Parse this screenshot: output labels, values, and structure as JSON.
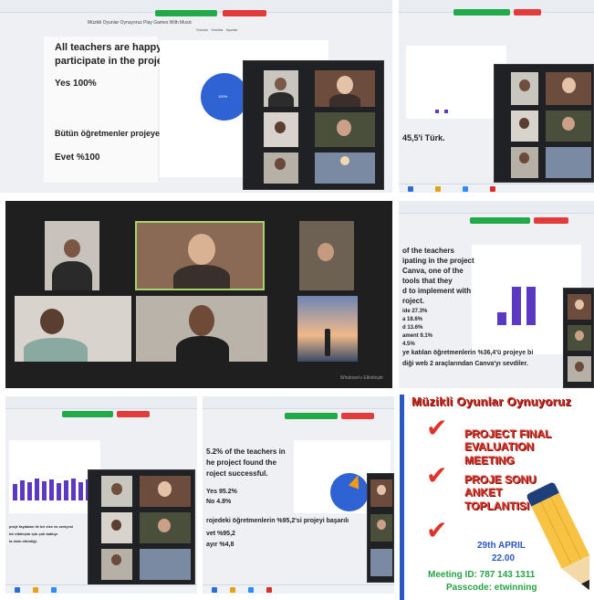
{
  "tile1": {
    "doc_title": "Müzikli Oyunlar Oynuyoruz Play Games With Music",
    "green_label": "Word canlandir | gönderimi",
    "red_label": "Toplantiyi Sonlandir",
    "tabs": [
      "Sorular",
      "Yanıtlar",
      "Ayarlar"
    ],
    "lines": [
      "All teachers are happy to",
      "participate in the project.",
      "Yes 100%",
      "Bütün öğretmenler projeye katıldıkları için mem...",
      "Evet %100"
    ],
    "pie_label": "100%"
  },
  "tile2": {
    "line": "45,5'i Türk."
  },
  "tile3": {
    "footer": "Windows'u Etkinleştir"
  },
  "tile4": {
    "lines": [
      "of the teachers",
      "ipating in the project",
      "Canva, one of the",
      "tools that they",
      "d to implement with",
      "roject.",
      "ide 27.3%",
      "a 18.6%",
      "d 13.6%",
      "ament 9.1%",
      "4.5%",
      "ye katılan öğretmenlerin %36,4'ü projeye bi",
      "diği web 2 araçlarından Canva'yı sevdiler."
    ]
  },
  "tile5": {
    "lines": [
      "proje faydaları ile bir vize vs seviyesi",
      "bir etkileşim için çok katkıyı",
      "la ekim etkinliği."
    ]
  },
  "tile6": {
    "lines": [
      "5.2% of the teachers in",
      "he project found the",
      "roject successful.",
      "Yes 95.2%",
      "No 4.8%",
      "rojedeki öğretmenlerin %95,2'si projeyi başarılı",
      "vet %95,2",
      "ayır %4,8"
    ]
  },
  "poster": {
    "header": "Müzikli Oyunlar Oynuyoruz",
    "block1": [
      "PROJECT FINAL",
      "EVALUATION",
      "MEETING"
    ],
    "block2": [
      "PROJE SONU",
      "ANKET",
      "TOPLANTISI"
    ],
    "date": "29th APRIL",
    "time": "22.00",
    "meeting_id": "Meeting ID: 787 143 1311",
    "passcode": "Passcode: etwinning"
  }
}
